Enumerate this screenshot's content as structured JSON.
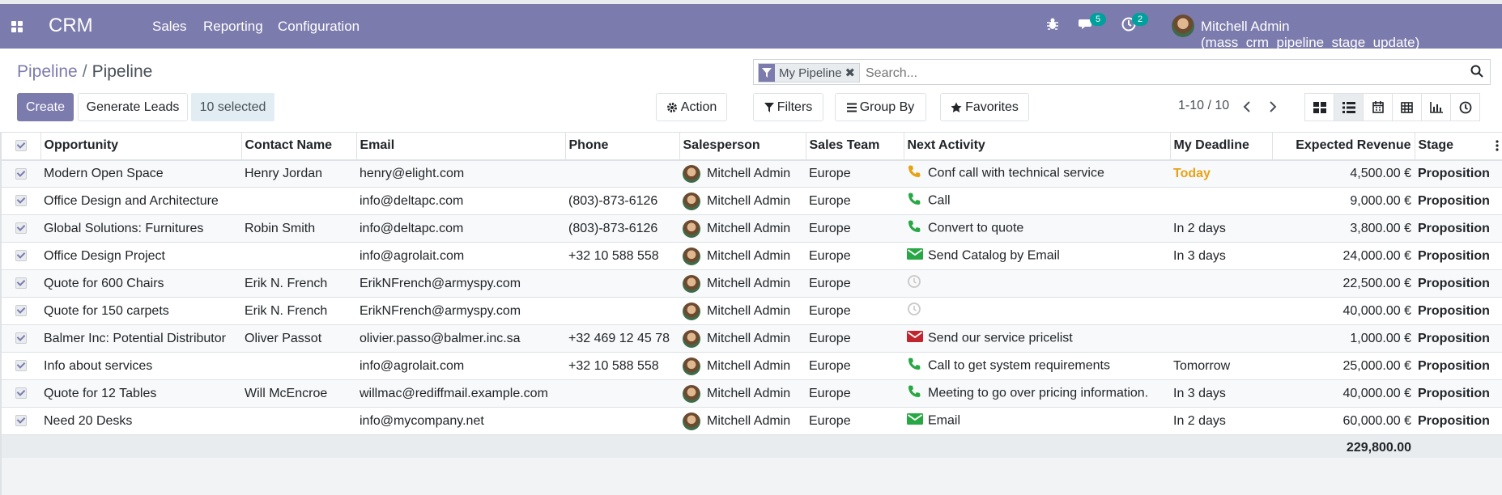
{
  "topbar": {
    "app_name": "CRM",
    "menus": [
      "Sales",
      "Reporting",
      "Configuration"
    ],
    "messages_count": "5",
    "activities_count": "2",
    "user": "Mitchell Admin (mass_crm_pipeline_stage_update)",
    "color": "#7c7bad"
  },
  "breadcrumb": {
    "parent": "Pipeline",
    "separator": "/",
    "current": "Pipeline"
  },
  "search": {
    "facet": "My Pipeline",
    "placeholder": "Search..."
  },
  "toolbar": {
    "create_label": "Create",
    "generate_label": "Generate Leads",
    "selected_label": "10 selected",
    "action_label": "Action",
    "filters_label": "Filters",
    "groupby_label": "Group By",
    "favorites_label": "Favorites"
  },
  "pager": {
    "text": "1-10 / 10"
  },
  "views": [
    "kanban-icon",
    "list-icon",
    "calendar-icon",
    "pivot-icon",
    "graph-icon",
    "activity-icon"
  ],
  "table": {
    "columns": [
      "Opportunity",
      "Contact Name",
      "Email",
      "Phone",
      "Salesperson",
      "Sales Team",
      "Next Activity",
      "My Deadline",
      "Expected Revenue",
      "Stage"
    ],
    "rows": [
      {
        "opportunity": "Modern Open Space",
        "contact": "Henry Jordan",
        "email": "henry@elight.com",
        "phone": "",
        "salesperson": "Mitchell Admin",
        "team": "Europe",
        "activity_icon": "phone-icon",
        "activity_color": "#e6a317",
        "activity": "Conf call with technical service",
        "deadline": "Today",
        "deadline_status": "today",
        "revenue": "4,500.00 €",
        "stage": "Proposition"
      },
      {
        "opportunity": "Office Design and Architecture",
        "contact": "",
        "email": "info@deltapc.com",
        "phone": "(803)-873-6126",
        "salesperson": "Mitchell Admin",
        "team": "Europe",
        "activity_icon": "phone-icon",
        "activity_color": "#28a745",
        "activity": "Call",
        "deadline": "",
        "deadline_status": "",
        "revenue": "9,000.00 €",
        "stage": "Proposition"
      },
      {
        "opportunity": "Global Solutions: Furnitures",
        "contact": "Robin Smith",
        "email": "info@deltapc.com",
        "phone": "(803)-873-6126",
        "salesperson": "Mitchell Admin",
        "team": "Europe",
        "activity_icon": "phone-icon",
        "activity_color": "#28a745",
        "activity": "Convert to quote",
        "deadline": "In 2 days",
        "deadline_status": "future",
        "revenue": "3,800.00 €",
        "stage": "Proposition"
      },
      {
        "opportunity": "Office Design Project",
        "contact": "",
        "email": "info@agrolait.com",
        "phone": "+32 10 588 558",
        "salesperson": "Mitchell Admin",
        "team": "Europe",
        "activity_icon": "envelope-icon",
        "activity_color": "#28a745",
        "activity": "Send Catalog by Email",
        "deadline": "In 3 days",
        "deadline_status": "future",
        "revenue": "24,000.00 €",
        "stage": "Proposition"
      },
      {
        "opportunity": "Quote for 600 Chairs",
        "contact": "Erik N. French",
        "email": "ErikNFrench@armyspy.com",
        "phone": "",
        "salesperson": "Mitchell Admin",
        "team": "Europe",
        "activity_icon": "clock-icon",
        "activity_color": "#c8c8c8",
        "activity": "",
        "deadline": "",
        "deadline_status": "",
        "revenue": "22,500.00 €",
        "stage": "Proposition"
      },
      {
        "opportunity": "Quote for 150 carpets",
        "contact": "Erik N. French",
        "email": "ErikNFrench@armyspy.com",
        "phone": "",
        "salesperson": "Mitchell Admin",
        "team": "Europe",
        "activity_icon": "clock-icon",
        "activity_color": "#c8c8c8",
        "activity": "",
        "deadline": "",
        "deadline_status": "",
        "revenue": "40,000.00 €",
        "stage": "Proposition"
      },
      {
        "opportunity": "Balmer Inc: Potential Distributor",
        "contact": "Oliver Passot",
        "email": "olivier.passo@balmer.inc.sa",
        "phone": "+32 469 12 45 78",
        "salesperson": "Mitchell Admin",
        "team": "Europe",
        "activity_icon": "envelope-icon",
        "activity_color": "#c0262d",
        "activity": "Send our service pricelist",
        "deadline": "",
        "deadline_status": "",
        "revenue": "1,000.00 €",
        "stage": "Proposition"
      },
      {
        "opportunity": "Info about services",
        "contact": "",
        "email": "info@agrolait.com",
        "phone": "+32 10 588 558",
        "salesperson": "Mitchell Admin",
        "team": "Europe",
        "activity_icon": "phone-icon",
        "activity_color": "#28a745",
        "activity": "Call to get system requirements",
        "deadline": "Tomorrow",
        "deadline_status": "future",
        "revenue": "25,000.00 €",
        "stage": "Proposition"
      },
      {
        "opportunity": "Quote for 12 Tables",
        "contact": "Will McEncroe",
        "email": "willmac@rediffmail.example.com",
        "phone": "",
        "salesperson": "Mitchell Admin",
        "team": "Europe",
        "activity_icon": "phone-icon",
        "activity_color": "#28a745",
        "activity": "Meeting to go over pricing information.",
        "deadline": "In 3 days",
        "deadline_status": "future",
        "revenue": "40,000.00 €",
        "stage": "Proposition"
      },
      {
        "opportunity": "Need 20 Desks",
        "contact": "",
        "email": "info@mycompany.net",
        "phone": "",
        "salesperson": "Mitchell Admin",
        "team": "Europe",
        "activity_icon": "envelope-icon",
        "activity_color": "#28a745",
        "activity": "Email",
        "deadline": "In 2 days",
        "deadline_status": "future",
        "revenue": "60,000.00 €",
        "stage": "Proposition"
      }
    ],
    "total_revenue": "229,800.00"
  }
}
